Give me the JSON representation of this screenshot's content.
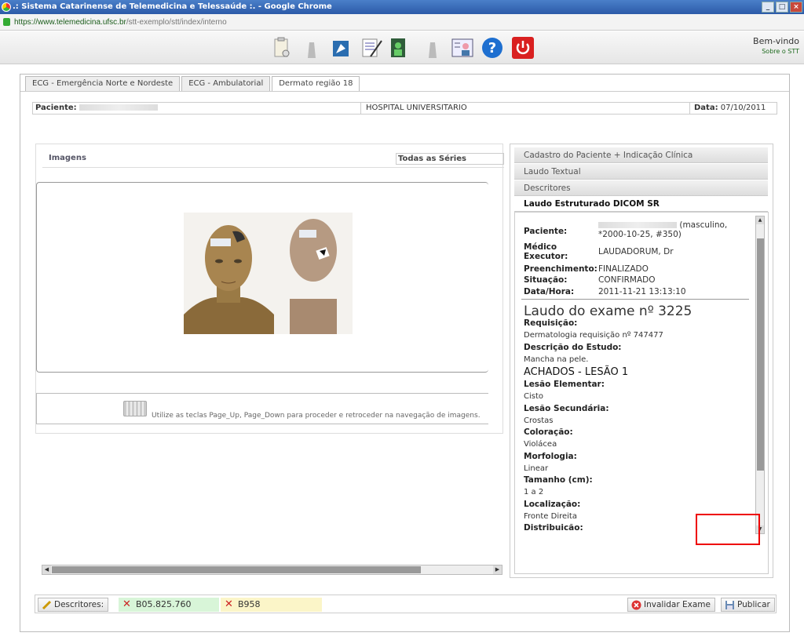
{
  "window": {
    "title": ".: Sistema Catarinense de Telemedicina e Telessaúde :. - Google Chrome"
  },
  "url": {
    "host": "https://www.telemedicina.ufsc.br",
    "path": "/stt-exemplo/stt/index/interno"
  },
  "header": {
    "welcome": "Bem-vindo",
    "about": "Sobre o STT"
  },
  "tabs": [
    {
      "label": "ECG - Emergência Norte e Nordeste"
    },
    {
      "label": "ECG - Ambulatorial"
    },
    {
      "label": "Dermato região 18"
    }
  ],
  "patient": {
    "label": "Paciente:",
    "hospital": "HOSPITAL UNIVERSITARIO",
    "date_label": "Data:",
    "date": "07/10/2011"
  },
  "images": {
    "label": "Imagens",
    "series": "Todas as Séries",
    "hint": "Utilize as teclas Page_Up, Page_Down para proceder e retroceder na navegação de imagens."
  },
  "accordion": [
    {
      "label": "Cadastro do Paciente + Indicação Clínica"
    },
    {
      "label": "Laudo Textual"
    },
    {
      "label": "Descritores"
    },
    {
      "label": "Laudo Estruturado DICOM SR"
    }
  ],
  "report": {
    "fields": [
      {
        "key": "Paciente:",
        "value": "(masculino, *2000-10-25, #350)"
      },
      {
        "key": "Médico Executor:",
        "value": "LAUDADORUM, Dr"
      },
      {
        "key": "Preenchimento:",
        "value": "FINALIZADO"
      },
      {
        "key": "Situação:",
        "value": "CONFIRMADO"
      },
      {
        "key": "Data/Hora:",
        "value": "2011-11-21 13:13:10"
      }
    ],
    "title": "Laudo do exame nº 3225",
    "req_label": "Requisição:",
    "req_value": "Dermatologia requisição nº 747477",
    "study_label": "Descrição do Estudo:",
    "study_value": "Mancha na pele.",
    "findings_title": "ACHADOS - LESÃO 1",
    "findings": [
      {
        "key": "Lesão Elementar:",
        "value": "Cisto"
      },
      {
        "key": "Lesão Secundária:",
        "value": "Crostas"
      },
      {
        "key": "Coloração:",
        "value": "Violácea"
      },
      {
        "key": "Morfologia:",
        "value": "Linear"
      },
      {
        "key": "Tamanho (cm):",
        "value": "1 a 2"
      },
      {
        "key": "Localização:",
        "value": "Fronte Direita"
      },
      {
        "key": "Distribuicão:",
        "value": ""
      }
    ]
  },
  "bottom": {
    "descritores_label": "Descritores:",
    "codes": [
      {
        "code": "B05.825.760",
        "color": "#d8f5d8"
      },
      {
        "code": "B958",
        "color": "#fbf5c8"
      }
    ],
    "invalidate_label": "Invalidar Exame",
    "publish_label": "Publicar"
  }
}
